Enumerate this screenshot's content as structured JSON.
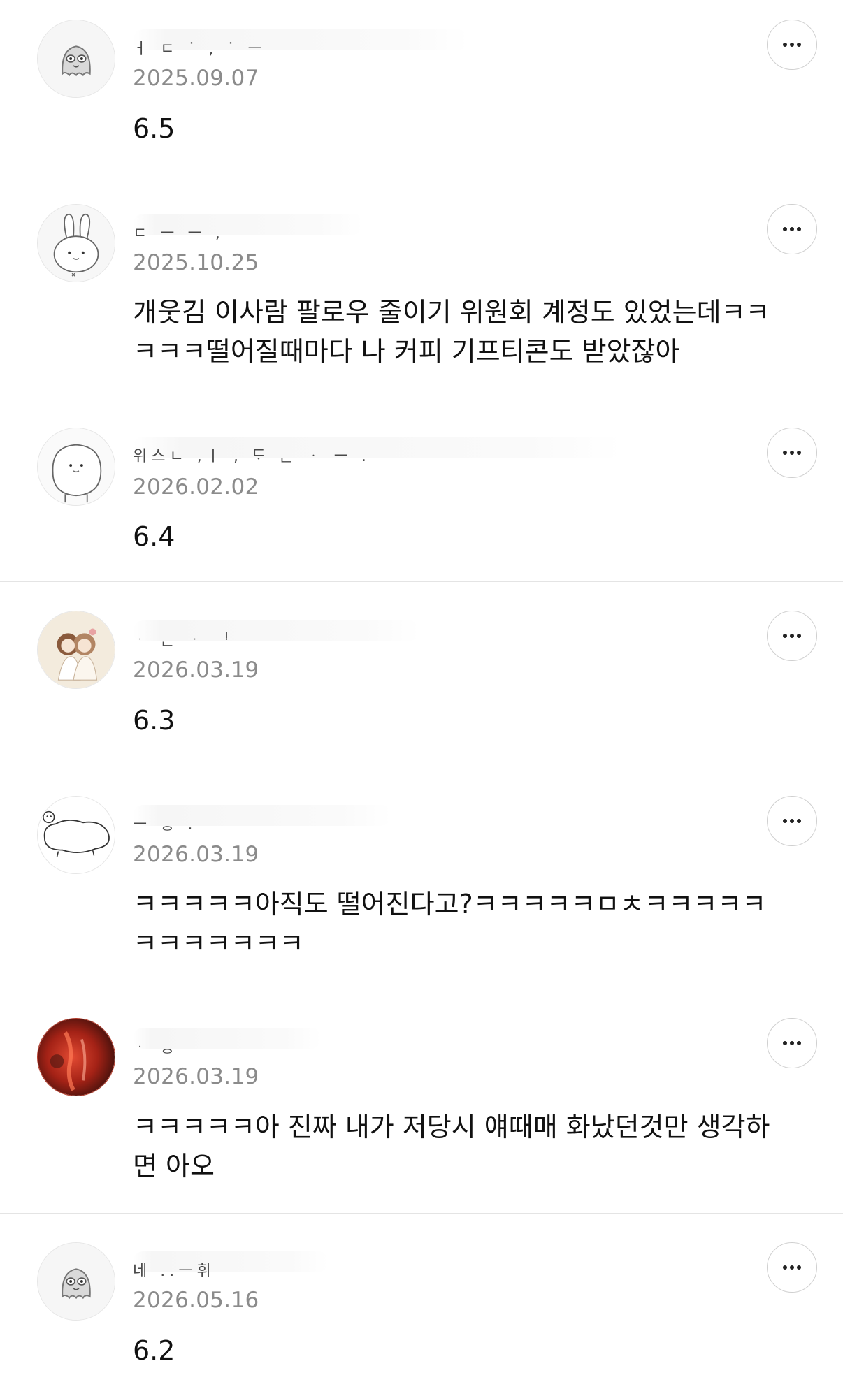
{
  "comments": [
    {
      "username_fragment": "ㅓ ㄷ   ˙   ,   ˙ ㅡ",
      "date": "2025.09.07",
      "text": "6.5",
      "avatar_icon": "ghost-character-icon"
    },
    {
      "username_fragment": "ㄷ   ㅡ ㅡ  ,",
      "date": "2025.10.25",
      "text": "개웃김 이사람 팔로우 줄이기 위원회 계정도 있었는데ㅋㅋ\nㅋㅋㅋ떨어질때마다 나 커피 기프티콘도 받았잖아",
      "avatar_icon": "rabbit-character-icon"
    },
    {
      "username_fragment": "위스ㄴ ,ㅣ    ,      ᄃᆞ ᆫ  ᆞ  ㅡ  .",
      "date": "2026.02.02",
      "text": "6.4",
      "avatar_icon": "cat-character-icon"
    },
    {
      "username_fragment": "ᆞ ᆫ ᆞ ᆝ",
      "date": "2026.03.19",
      "text": "6.3",
      "avatar_icon": "illustrated-girls-icon"
    },
    {
      "username_fragment": "ㅡ ᆼ  .",
      "date": "2026.03.19",
      "text": "ㅋㅋㅋㅋㅋ아직도 떨어진다고?ㅋㅋㅋㅋㅋㅁㅊㅋㅋㅋㅋㅋ\nㅋㅋㅋㅋㅋㅋㅋ",
      "avatar_icon": "cloud-cat-icon"
    },
    {
      "username_fragment": "ᆞ ᆼ",
      "date": "2026.03.19",
      "text": "ㅋㅋㅋㅋㅋ아 진짜 내가 저당시 얘때매 화났던것만 생각하\n면 아오",
      "avatar_icon": "red-photo-icon"
    },
    {
      "username_fragment": "네 ..ㅡ휘",
      "date": "2026.05.16",
      "text": "6.2",
      "avatar_icon": "ghost-character-icon"
    }
  ],
  "more_button_label": "More options"
}
